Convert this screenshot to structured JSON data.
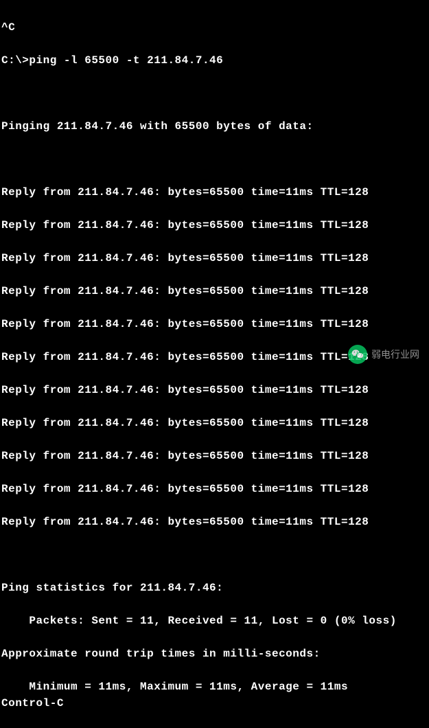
{
  "interrupt": "^C",
  "prompt": "C:\\>",
  "command": "ping -l 65500 -t 211.84.7.46",
  "header": "Pinging 211.84.7.46 with 65500 bytes of data:",
  "replies": [
    "Reply from 211.84.7.46: bytes=65500 time=11ms TTL=128",
    "Reply from 211.84.7.46: bytes=65500 time=11ms TTL=128",
    "Reply from 211.84.7.46: bytes=65500 time=11ms TTL=128",
    "Reply from 211.84.7.46: bytes=65500 time=11ms TTL=128",
    "Reply from 211.84.7.46: bytes=65500 time=11ms TTL=128",
    "Reply from 211.84.7.46: bytes=65500 time=11ms TTL=128",
    "Reply from 211.84.7.46: bytes=65500 time=11ms TTL=128",
    "Reply from 211.84.7.46: bytes=65500 time=11ms TTL=128",
    "Reply from 211.84.7.46: bytes=65500 time=11ms TTL=128",
    "Reply from 211.84.7.46: bytes=65500 time=11ms TTL=128",
    "Reply from 211.84.7.46: bytes=65500 time=11ms TTL=128"
  ],
  "stats_title": "Ping statistics for 211.84.7.46:",
  "packets_line": "    Packets: Sent = 11, Received = 11, Lost = 0 (0% loss)",
  "rtt_title": "Approximate round trip times in milli-seconds:",
  "rtt_line": "    Minimum = 11ms, Maximum = 11ms, Average = 11ms",
  "control_c": "Control-C",
  "watermark": "弱电行业网"
}
